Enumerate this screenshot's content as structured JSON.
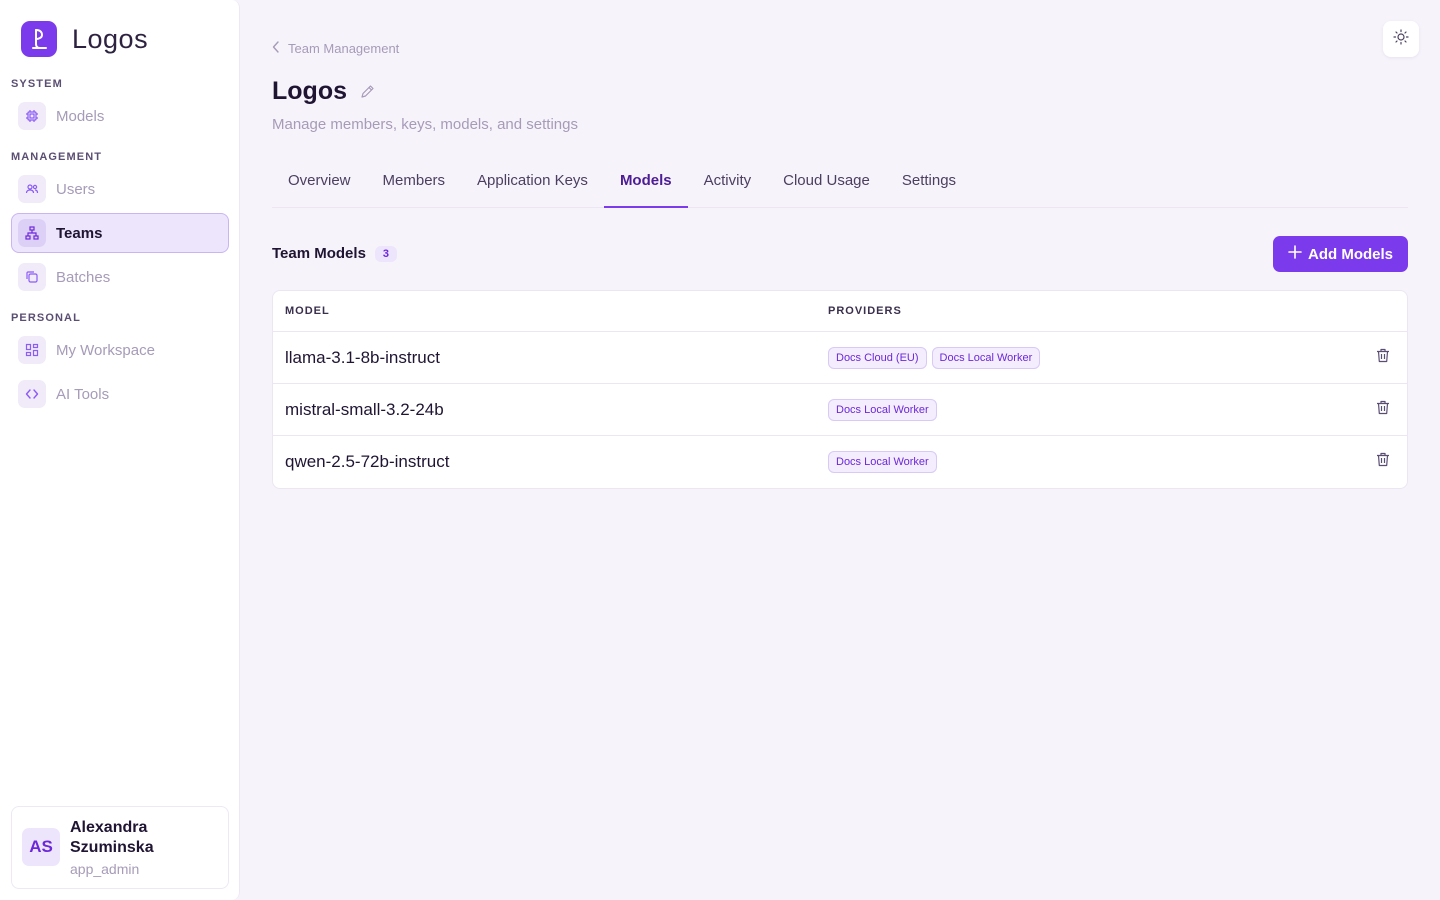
{
  "app": {
    "name": "Logos"
  },
  "sidebar": {
    "sections": [
      {
        "label": "SYSTEM",
        "items": [
          {
            "label": "Models",
            "icon": "chip-icon"
          }
        ]
      },
      {
        "label": "MANAGEMENT",
        "items": [
          {
            "label": "Users",
            "icon": "users-icon"
          },
          {
            "label": "Teams",
            "icon": "hierarchy-icon",
            "active": true
          },
          {
            "label": "Batches",
            "icon": "copy-icon"
          }
        ]
      },
      {
        "label": "PERSONAL",
        "items": [
          {
            "label": "My Workspace",
            "icon": "grid-icon"
          },
          {
            "label": "AI Tools",
            "icon": "code-icon"
          }
        ]
      }
    ],
    "user": {
      "initials": "AS",
      "name": "Alexandra Szuminska",
      "role": "app_admin"
    }
  },
  "header": {
    "breadcrumb": "Team Management",
    "title": "Logos",
    "subtitle": "Manage members, keys, models, and settings"
  },
  "tabs": [
    {
      "label": "Overview"
    },
    {
      "label": "Members"
    },
    {
      "label": "Application Keys"
    },
    {
      "label": "Models",
      "active": true
    },
    {
      "label": "Activity"
    },
    {
      "label": "Cloud Usage"
    },
    {
      "label": "Settings"
    }
  ],
  "team_models": {
    "title": "Team Models",
    "count": "3",
    "add_button": "Add Models",
    "columns": {
      "model": "MODEL",
      "providers": "PROVIDERS"
    },
    "rows": [
      {
        "model": "llama-3.1-8b-instruct",
        "providers": [
          "Docs Cloud (EU)",
          "Docs Local Worker"
        ]
      },
      {
        "model": "mistral-small-3.2-24b",
        "providers": [
          "Docs Local Worker"
        ]
      },
      {
        "model": "qwen-2.5-72b-instruct",
        "providers": [
          "Docs Local Worker"
        ]
      }
    ]
  },
  "colors": {
    "accent": "#7c3aed",
    "background": "#f7f3fb",
    "muted_text": "#a69bb8"
  }
}
